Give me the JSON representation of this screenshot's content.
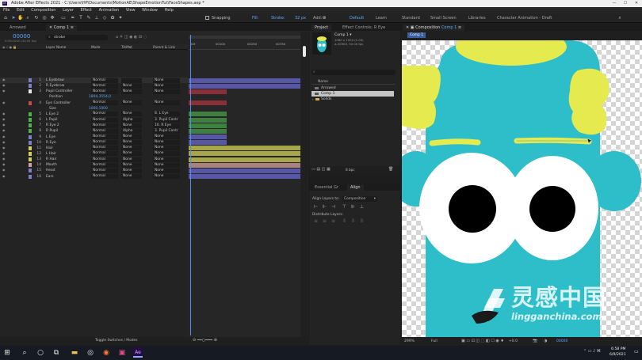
{
  "titlebar": {
    "title": "Adobe After Effects 2021 - C:\\Users\\HP\\Documents\\MotionAE\\ShapeEmotionTut\\FaceShapes.aep *",
    "minimize": "—",
    "maximize": "☐",
    "close": "✕"
  },
  "menu": [
    "File",
    "Edit",
    "Composition",
    "Layer",
    "Effect",
    "Animation",
    "View",
    "Window",
    "Help"
  ],
  "toolbar": {
    "snapping_label": "Snapping",
    "fill_label": "Fill:",
    "stroke_label": "Stroke:",
    "stroke_width": "32 px",
    "add_label": "Add:",
    "workspaces": [
      "Default",
      "Learn",
      "Standard",
      "Small Screen",
      "Libraries",
      "Character Animation - Draft"
    ]
  },
  "left_tabs": {
    "arrowed": "Arrowed",
    "comp1": "Comp 1"
  },
  "timeline": {
    "timecode": "00000",
    "timecode_sub": "0:00:00:00 (30.00 fps)",
    "search_value": "stroke",
    "columns": {
      "layer_name": "Layer Name",
      "mode": "Mode",
      "trkmat": "TrkMat",
      "parent": "Parent & Link"
    },
    "ruler_labels": [
      "00f",
      "00100",
      "00250",
      "00750"
    ],
    "toggle_label": "Toggle Switches / Modes",
    "layers": [
      {
        "num": "1",
        "name": "L Eyebrow",
        "mode": "Normal",
        "trkmat": "",
        "parent": "None",
        "color": "#7d7fc9",
        "bar": "#5757a6",
        "bar_from": 0,
        "bar_to": 1
      },
      {
        "num": "2",
        "name": "R Eyebrow",
        "mode": "Normal",
        "trkmat": "None",
        "parent": "None",
        "color": "#7d7fc9",
        "bar": "#5757a6",
        "bar_from": 0,
        "bar_to": 1
      },
      {
        "num": "3",
        "name": "Pupil Controller",
        "mode": "Normal",
        "trkmat": "None",
        "parent": "None",
        "color": "#e8e8e8",
        "bar": "#8a2f38",
        "bar_from": 0,
        "bar_to": 0.34
      },
      {
        "num": "",
        "name": "Position",
        "mode": "",
        "trkmat": "",
        "parent": "",
        "color": "",
        "bar": "",
        "bar_from": 0,
        "bar_to": 0,
        "value": "1804,3554,0"
      },
      {
        "num": "4",
        "name": "Eye Controller",
        "mode": "Normal",
        "trkmat": "None",
        "parent": "None",
        "color": "#c84b4b",
        "bar": "#8a2f38",
        "bar_from": 0,
        "bar_to": 0.34
      },
      {
        "num": "",
        "name": "Size",
        "mode": "",
        "trkmat": "",
        "parent": "",
        "color": "",
        "bar": "",
        "bar_from": 0,
        "bar_to": 0,
        "value": "1000,1000"
      },
      {
        "num": "5",
        "name": "L Eye 2",
        "mode": "Normal",
        "trkmat": "None",
        "parent": "8. L Eye",
        "color": "#4fb04f",
        "bar": "#3f7f3f",
        "bar_from": 0,
        "bar_to": 0.34
      },
      {
        "num": "6",
        "name": "L Pupil",
        "mode": "Normal",
        "trkmat": "Alpha",
        "parent": "3. Pupil Contr",
        "color": "#4fb04f",
        "bar": "#3f7f3f",
        "bar_from": 0,
        "bar_to": 0.34
      },
      {
        "num": "7",
        "name": "R Eye 2",
        "mode": "Normal",
        "trkmat": "None",
        "parent": "10. R Eye",
        "color": "#4fb04f",
        "bar": "#3f7f3f",
        "bar_from": 0,
        "bar_to": 0.34
      },
      {
        "num": "8",
        "name": "R Pupil",
        "mode": "Normal",
        "trkmat": "Alpha",
        "parent": "3. Pupil Contr",
        "color": "#4fb04f",
        "bar": "#3f7f3f",
        "bar_from": 0,
        "bar_to": 0.34
      },
      {
        "num": "9",
        "name": "L Eye",
        "mode": "Normal",
        "trkmat": "None",
        "parent": "None",
        "color": "#7d7fc9",
        "bar": "#5757a6",
        "bar_from": 0,
        "bar_to": 0.34
      },
      {
        "num": "10",
        "name": "R Eye",
        "mode": "Normal",
        "trkmat": "None",
        "parent": "None",
        "color": "#7d7fc9",
        "bar": "#5757a6",
        "bar_from": 0,
        "bar_to": 0.34
      },
      {
        "num": "11",
        "name": "Hair",
        "mode": "Normal",
        "trkmat": "None",
        "parent": "None",
        "color": "#d2cf5b",
        "bar": "#a8a64a",
        "bar_from": 0,
        "bar_to": 1
      },
      {
        "num": "12",
        "name": "L Hair",
        "mode": "Normal",
        "trkmat": "None",
        "parent": "None",
        "color": "#d2cf5b",
        "bar": "#a8a64a",
        "bar_from": 0,
        "bar_to": 1
      },
      {
        "num": "13",
        "name": "R Hair",
        "mode": "Normal",
        "trkmat": "None",
        "parent": "None",
        "color": "#d2cf5b",
        "bar": "#a8a64a",
        "bar_from": 0,
        "bar_to": 1
      },
      {
        "num": "14",
        "name": "Mouth",
        "mode": "Normal",
        "trkmat": "None",
        "parent": "None",
        "color": "#d2a0a0",
        "bar": "#a98181",
        "bar_from": 0,
        "bar_to": 1
      },
      {
        "num": "15",
        "name": "Head",
        "mode": "Normal",
        "trkmat": "None",
        "parent": "None",
        "color": "#7d7fc9",
        "bar": "#5757a6",
        "bar_from": 0,
        "bar_to": 1
      },
      {
        "num": "16",
        "name": "Ears",
        "mode": "Normal",
        "trkmat": "None",
        "parent": "None",
        "color": "#7d7fc9",
        "bar": "#5757a6",
        "bar_from": 0,
        "bar_to": 1
      }
    ]
  },
  "project": {
    "tab": "Project",
    "effect_tab": "Effect Controls: R Eye",
    "comp_name": "Comp 1 ▾",
    "comp_info1": "1080 x 1920 (1.00)",
    "comp_info2": "Δ 00900, 30.00 fps",
    "search_placeholder": "",
    "name_header": "Name",
    "items": [
      "Arrowed",
      "Comp 1",
      "Solids"
    ],
    "bpc": "8 bpc"
  },
  "align": {
    "tab_essential": "Essential Gr",
    "tab_align": "Align",
    "align_to_label": "Align Layers to:",
    "align_to_value": "Composition",
    "distribute_label": "Distribute Layers:"
  },
  "composition": {
    "tab": "Composition",
    "comp_link": "Comp 1",
    "sub_tab": "Comp 1",
    "zoom": "299%",
    "resolution": "Full",
    "timecode": "00000",
    "offset": "+0.0"
  },
  "watermark": {
    "brand": "灵感中国",
    "url": "lingganchina.com"
  },
  "taskbar": {
    "time": "6:58 PM",
    "date": "6/9/2021"
  },
  "colors": {
    "body": "#2dbec9",
    "hair": "#e5ea4e",
    "eye_white": "#ffffff",
    "pupil": "#000000",
    "accent_blue": "#5da6ff"
  }
}
